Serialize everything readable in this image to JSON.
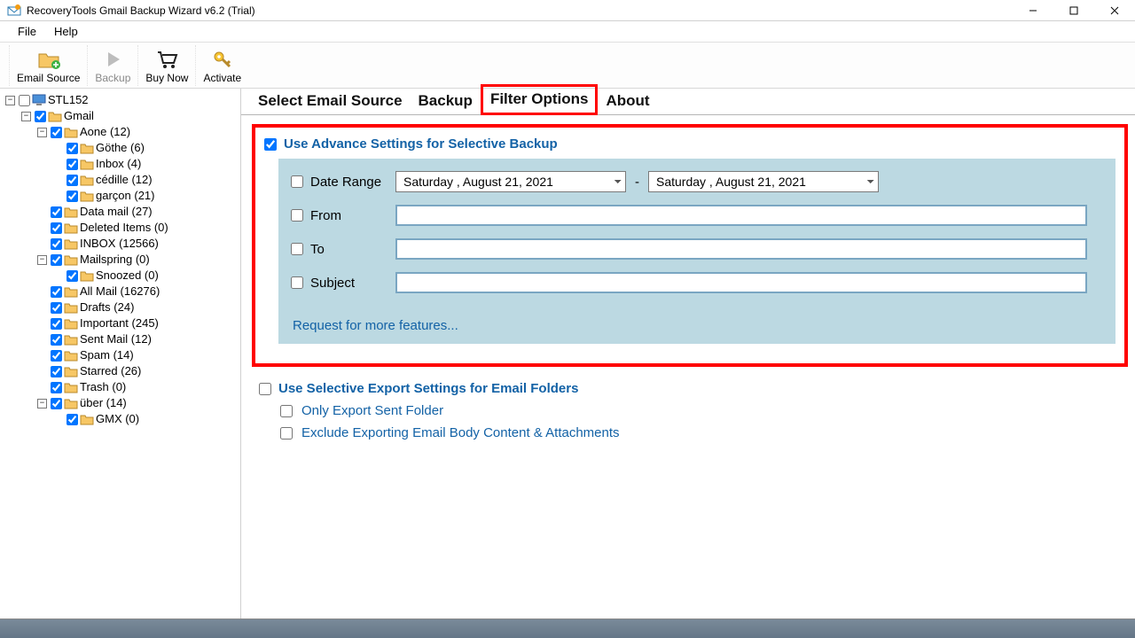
{
  "window": {
    "title": "RecoveryTools Gmail Backup Wizard v6.2 (Trial)"
  },
  "menus": {
    "file": "File",
    "help": "Help"
  },
  "toolbar": {
    "email_source": "Email Source",
    "backup": "Backup",
    "buy_now": "Buy Now",
    "activate": "Activate"
  },
  "tree": {
    "root": "STL152",
    "gmail": "Gmail",
    "aone": "Aone (12)",
    "gothe": "Göthe (6)",
    "inbox_small": "Inbox (4)",
    "cedille": "cédille (12)",
    "garcon": "garçon (21)",
    "data_mail": "Data mail (27)",
    "deleted": "Deleted Items (0)",
    "inbox_big": "INBOX (12566)",
    "mailspring": "Mailspring (0)",
    "snoozed": "Snoozed (0)",
    "all_mail": "All Mail (16276)",
    "drafts": "Drafts (24)",
    "important": "Important (245)",
    "sent": "Sent Mail (12)",
    "spam": "Spam (14)",
    "starred": "Starred (26)",
    "trash": "Trash (0)",
    "uber": "über (14)",
    "gmx": "GMX (0)"
  },
  "tabs": {
    "select_source": "Select Email Source",
    "backup": "Backup",
    "filter_options": "Filter Options",
    "about": "About"
  },
  "filters": {
    "advance_heading": "Use Advance Settings for Selective Backup",
    "date_range_label": "Date Range",
    "date_from": "Saturday ,    August   21, 2021",
    "date_to": "Saturday ,    August   21, 2021",
    "dash": "-",
    "from_label": "From",
    "to_label": "To",
    "subject_label": "Subject",
    "more_link": "Request for more features...",
    "selective_heading": "Use Selective Export Settings for Email Folders",
    "only_sent": "Only Export Sent Folder",
    "exclude_body": "Exclude Exporting Email Body Content & Attachments"
  }
}
